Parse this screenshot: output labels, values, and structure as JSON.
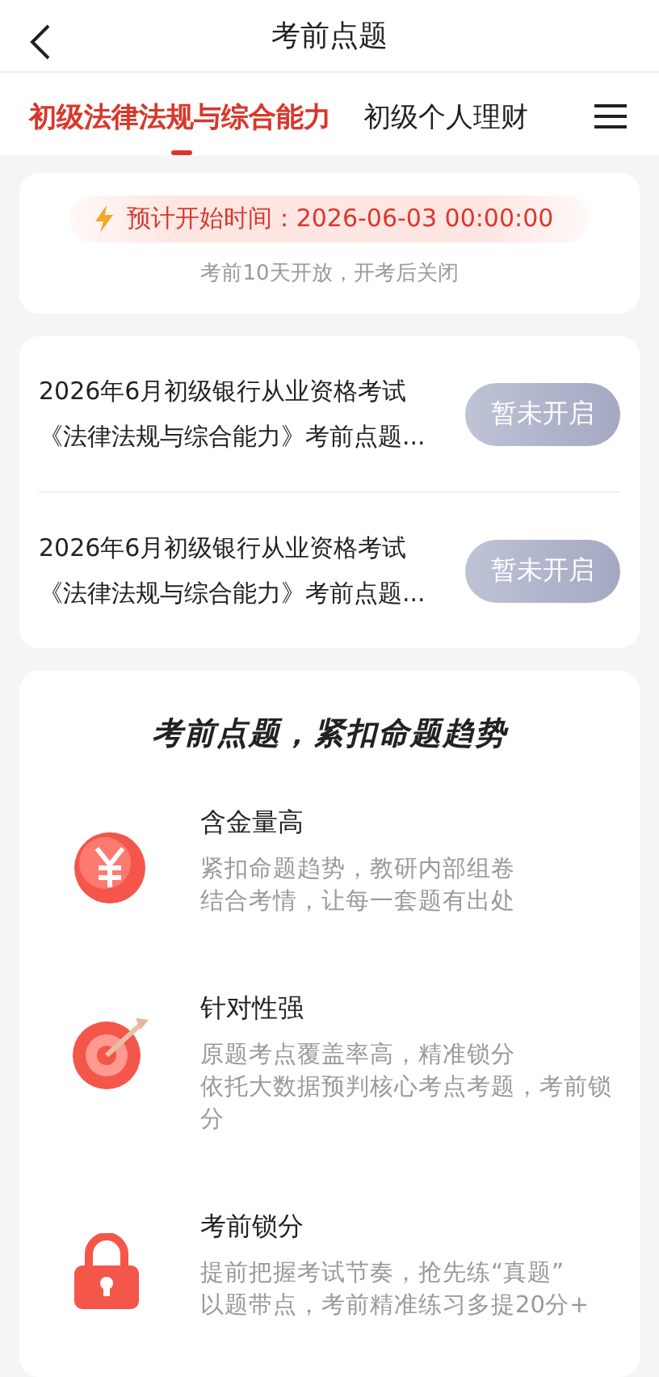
{
  "header": {
    "title": "考前点题"
  },
  "tabs": [
    {
      "label": "初级法律法规与综合能力",
      "selected": true
    },
    {
      "label": "初级个人理财",
      "selected": false
    }
  ],
  "notice": {
    "start_time": "预计开始时间：2026-06-03 00:00:00",
    "note": "考前10天开放，开考后关闭"
  },
  "exams": [
    {
      "title": "2026年6月初级银行从业资格考试《法律法规与综合能力》考前点题...",
      "button": "暂未开启",
      "disabled": true
    },
    {
      "title": "2026年6月初级银行从业资格考试《法律法规与综合能力》考前点题...",
      "button": "暂未开启",
      "disabled": true
    }
  ],
  "features": {
    "heading": "考前点题，紧扣命题趋势",
    "items": [
      {
        "kind": "coin",
        "title": "含金量高",
        "lines": [
          "紧扣命题趋势，教研内部组卷",
          "结合考情，让每一套题有出处"
        ]
      },
      {
        "kind": "target",
        "title": "针对性强",
        "lines": [
          "原题考点覆盖率高，精准锁分",
          "依托大数据预判核心考点考题，考前锁分"
        ]
      },
      {
        "kind": "lock",
        "title": "考前锁分",
        "lines": [
          "提前把握考试节奏，抢先练“真题”",
          "以题带点，考前精准练习多提20分+"
        ]
      }
    ]
  }
}
